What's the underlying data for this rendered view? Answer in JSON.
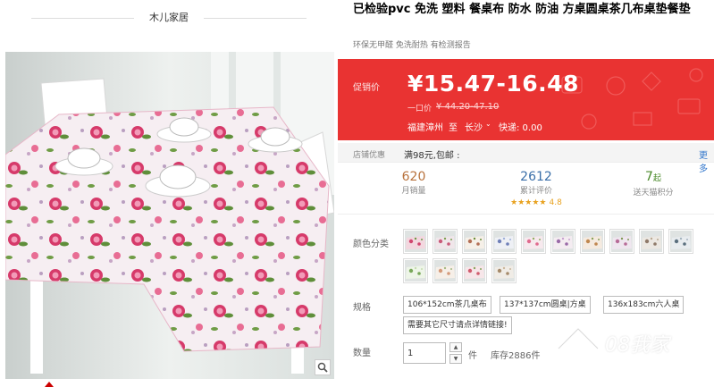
{
  "store": {
    "name": "木儿家居"
  },
  "product": {
    "title": "已检验pvc 免洗 塑料 餐桌布 防水 防油 方桌圆桌茶几布桌垫餐垫",
    "subtitle": "环保无甲醛 免洗耐热 有检测报告"
  },
  "price": {
    "label": "促销价",
    "value": "¥15.47-16.48",
    "original_label": "一口价",
    "original_value": "¥ 44.20-47.10",
    "ship_from": "福建漳州",
    "ship_to_label": "至",
    "ship_destination": "长沙",
    "ship_fee": "快递: 0.00"
  },
  "promo": {
    "label": "店铺优惠",
    "text": "满98元,包邮 :",
    "more": "更多"
  },
  "stats": {
    "sales_value": "620",
    "sales_label": "月销量",
    "reviews_value": "2612",
    "reviews_label": "累计评价",
    "rating_stars": "★★★★★",
    "rating_score": "4.8",
    "points_value": "7",
    "points_unit": "起",
    "points_label": "送天猫积分"
  },
  "sku": {
    "color_label": "颜色分类",
    "swatch_count": 14,
    "spec_label": "规格",
    "spec_options": [
      "106*152cm茶几桌布",
      "137*137cm圆桌|方桌",
      "136x183cm六人桌",
      "需要其它尺寸请点详情链接!"
    ]
  },
  "quantity": {
    "label": "数量",
    "value": "1",
    "unit": "件",
    "stock": "库存2886件"
  },
  "watermark": {
    "text": "08我家"
  },
  "colors": {
    "price_red": "#e93332",
    "reviews_blue": "#3a6fa8",
    "sales_brown": "#b8723c",
    "points_green": "#4b8a2b",
    "star_gold": "#e8a220"
  },
  "icons": {
    "zoom": "magnifier-icon",
    "caret": "chevron-down-icon"
  }
}
